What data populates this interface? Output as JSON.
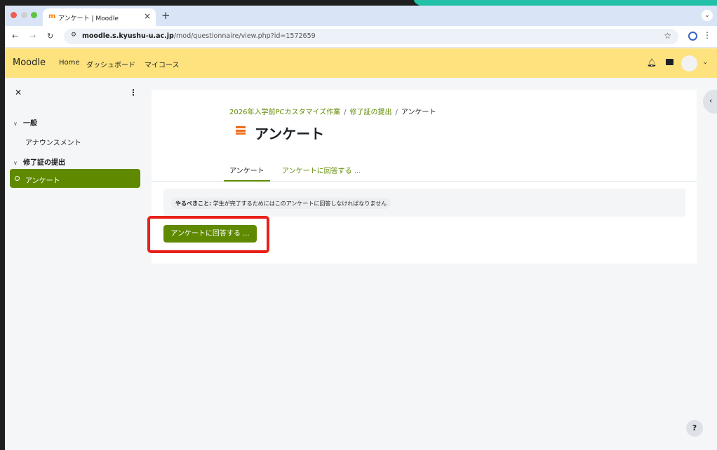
{
  "browser": {
    "tab_title": "アンケート | Moodle",
    "favicon": "m",
    "tab_close": "×",
    "new_tab": "+",
    "tab_menu": "⌄",
    "url_host": "moodle.s.kyushu-u.ac.jp",
    "url_path": "/mod/questionnaire/view.php?id=1572659",
    "icons": [
      "back-icon",
      "forward-icon",
      "reload-icon",
      "site-settings-icon",
      "bookmark-star-icon",
      "profile-icon",
      "browser-menu-icon"
    ]
  },
  "navbar": {
    "brand": "Moodle",
    "links": [
      "Home",
      "ダッシュボード",
      "マイコース"
    ]
  },
  "drawer": {
    "sections": [
      {
        "title": "一般",
        "items": [
          "アナウンスメント"
        ]
      },
      {
        "title": "修了証の提出",
        "items": [
          "アンケート"
        ]
      }
    ],
    "active_item": "アンケート"
  },
  "main": {
    "breadcrumb": [
      "2026年入学前PCカスタマイズ作業",
      "修了証の提出",
      "アンケート"
    ],
    "breadcrumb_sep": "/",
    "title": "アンケート",
    "tabs": [
      "アンケート",
      "アンケートに回答する ..."
    ],
    "todo_label": "やるべきこと:",
    "todo_text": " 学生が完了するためにはこのアンケートに回答しなければなりません",
    "cta_label": "アンケートに回答する ..."
  },
  "help_label": "?",
  "colors": {
    "navbar_bg": "#fde27e",
    "accent_green": "#5f8a00",
    "highlight_red": "#e8221a",
    "activity_icon": "#f06c1e"
  }
}
